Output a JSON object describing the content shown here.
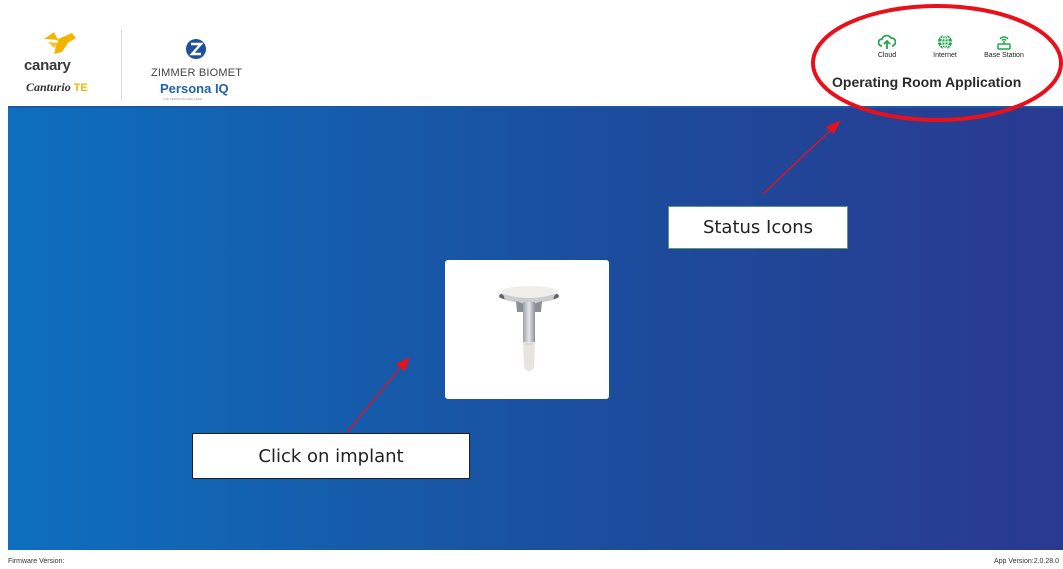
{
  "header": {
    "canary_logo": {
      "word": "canary",
      "tm": "·",
      "product_name": "Canturio",
      "product_suffix": "TE"
    },
    "zimmer_logo": {
      "brand": "ZIMMER BIOMET",
      "product_prefix": "Persona",
      "product_suffix": "IQ",
      "tagline": "THE PERSONALIZED KNEE"
    },
    "status_icons": [
      {
        "label": "Cloud",
        "icon": "cloud-upload-icon"
      },
      {
        "label": "Internet",
        "icon": "globe-icon"
      },
      {
        "label": "Base Station",
        "icon": "base-station-icon"
      }
    ],
    "app_title": "Operating Room Application"
  },
  "main": {
    "implant_card": {
      "icon": "tibial-implant-image"
    }
  },
  "annotations": {
    "status_callout": "Status Icons",
    "implant_callout": "Click on implant"
  },
  "footer": {
    "firmware_version": "Firmware Version:",
    "app_version": "App Version:2.0.28.0"
  },
  "colors": {
    "main_gradient_start": "#0e6fbf",
    "main_gradient_end": "#2a3990",
    "status_icon_green": "#1fa84a",
    "annotation_red": "#e8101a",
    "canary_yellow": "#f3b400"
  }
}
